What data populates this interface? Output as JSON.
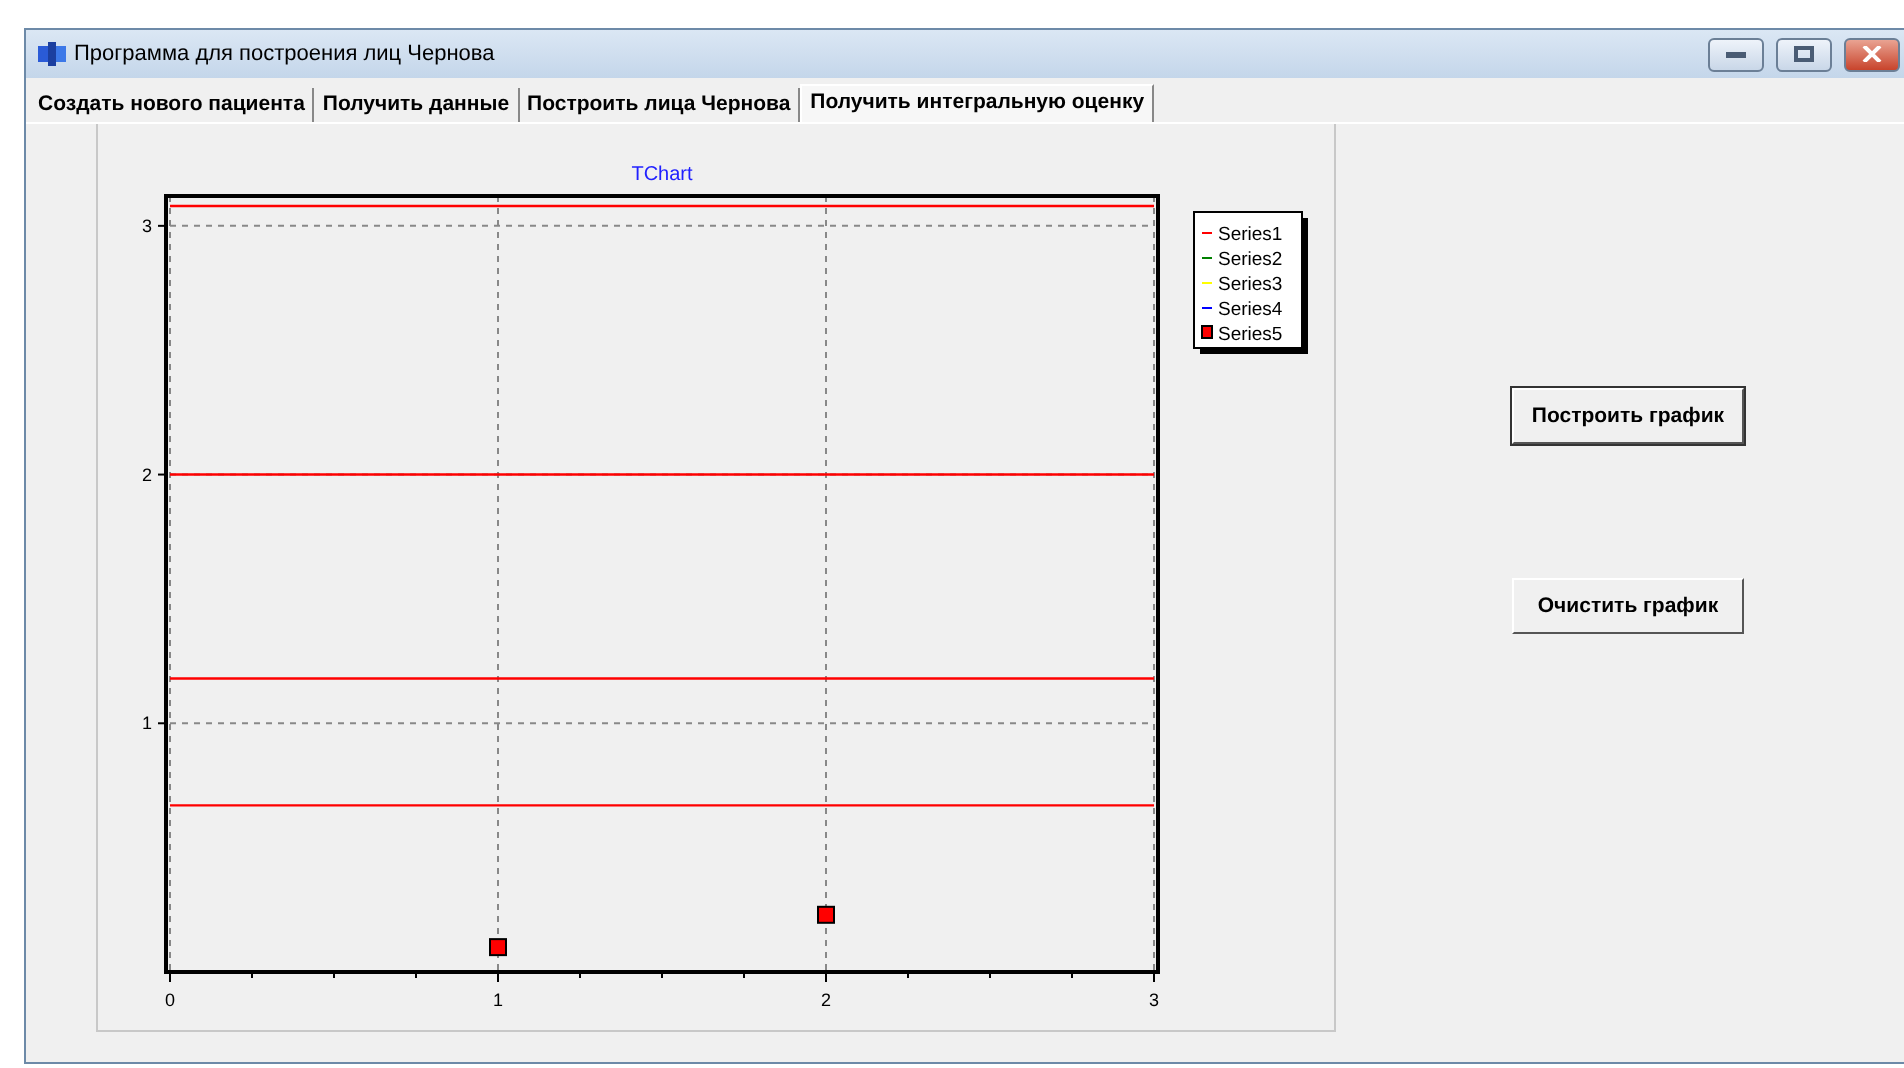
{
  "window": {
    "title": "Программа для построения лиц Чернова"
  },
  "tabs": [
    {
      "label": "Создать нового пациента",
      "selected": false
    },
    {
      "label": "Получить данные",
      "selected": false
    },
    {
      "label": "Построить лица Чернова",
      "selected": false
    },
    {
      "label": "Получить интегральную оценку",
      "selected": true
    }
  ],
  "chart": {
    "chart_data": {
      "type": "scatter",
      "title": "TChart",
      "x": [
        1,
        2
      ],
      "xlim": [
        0,
        3
      ],
      "ylim": [
        0,
        3.12
      ],
      "xticks": [
        0,
        1,
        2,
        3
      ],
      "yticks": [
        1,
        2,
        3
      ],
      "grid": true,
      "legend": true,
      "ref_lines": [
        {
          "axis": "y",
          "value": 3.08,
          "color": "#ff0000"
        },
        {
          "axis": "y",
          "value": 2.0,
          "color": "#ff0000"
        },
        {
          "axis": "y",
          "value": 1.18,
          "color": "#ff0000"
        },
        {
          "axis": "y",
          "value": 0.67,
          "color": "#ff0000"
        }
      ],
      "series": [
        {
          "name": "Series1",
          "color": "#ff0000",
          "type": "line",
          "values": [
            null,
            null
          ]
        },
        {
          "name": "Series2",
          "color": "#008000",
          "type": "line",
          "values": [
            null,
            null
          ]
        },
        {
          "name": "Series3",
          "color": "#ffff00",
          "type": "line",
          "values": [
            null,
            null
          ]
        },
        {
          "name": "Series4",
          "color": "#0000ff",
          "type": "line",
          "values": [
            null,
            null
          ]
        },
        {
          "name": "Series5",
          "color": "#ff0000",
          "values": [
            0.1,
            0.23
          ]
        }
      ]
    }
  },
  "buttons": [
    "Построить график",
    "Очистить график"
  ]
}
